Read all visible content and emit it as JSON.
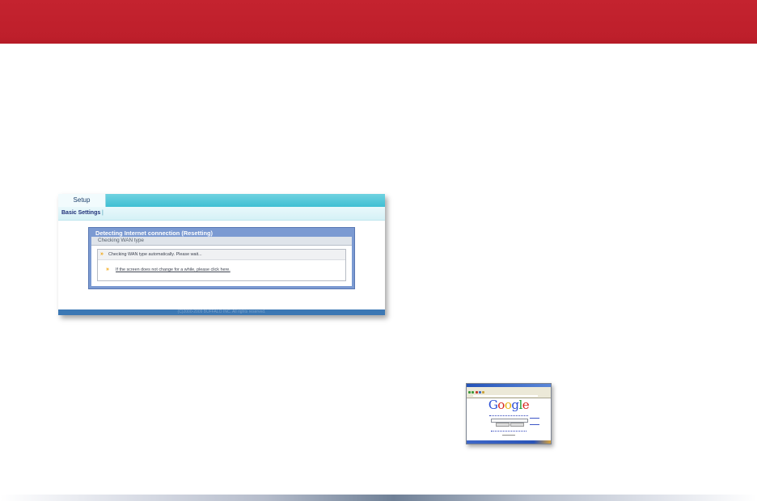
{
  "router": {
    "tab_setup": "Setup",
    "nav_basic_settings": "Basic Settings",
    "nav_separator": "|",
    "detect_title": "Detecting Internet connection (Resetting)",
    "wan_header": "Checking WAN type",
    "status_message": "Checking WAN type automatically. Please wait...",
    "fallback_link": "If the screen does not change for a while, please click here.",
    "footer": "(C)2000-2009 BUFFALO INC. All rights reserved.",
    "bullet_glyph": "»"
  },
  "browser": {
    "logo_letters": [
      "G",
      "o",
      "o",
      "g",
      "l",
      "e"
    ],
    "logo_colors": [
      "#2a4fd6",
      "#d6281e",
      "#e8b10b",
      "#2a4fd6",
      "#1a9a2d",
      "#d6281e"
    ]
  },
  "colors": {
    "banner": "#c4232f",
    "router_frame": "#7b9ad2",
    "router_footer": "#3c78b4",
    "bullet": "#f2a100"
  }
}
